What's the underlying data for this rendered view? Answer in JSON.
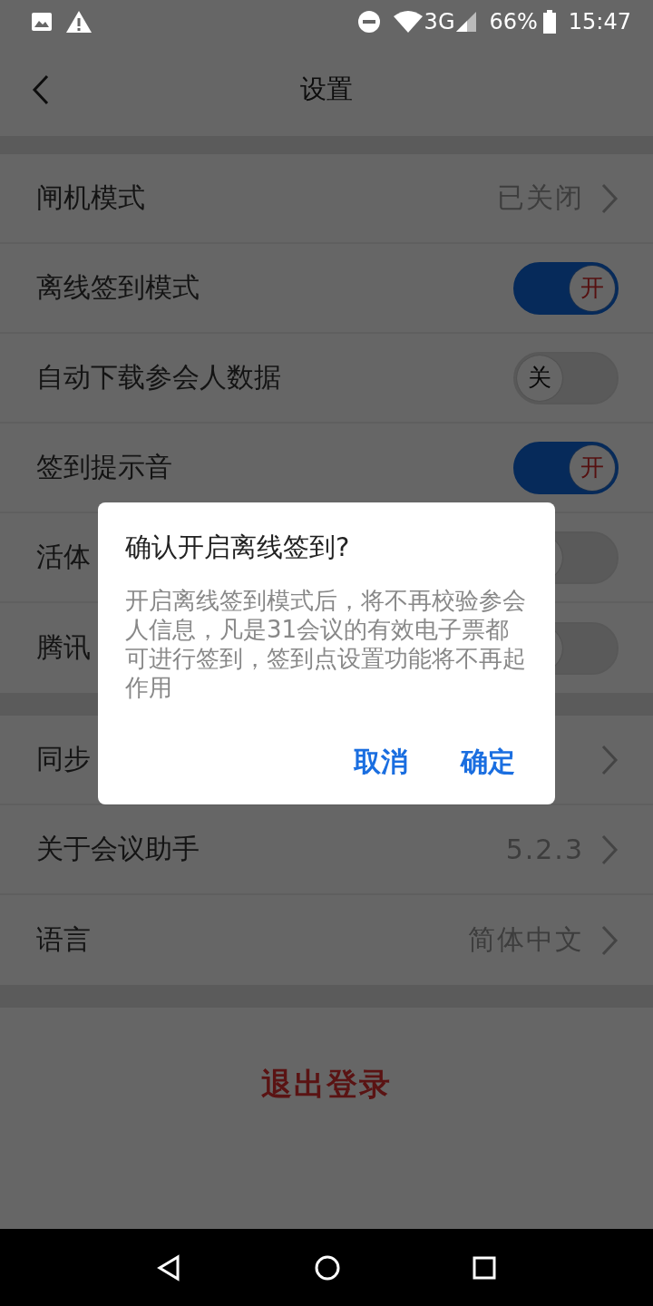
{
  "status_bar": {
    "network": "3G",
    "battery": "66%",
    "time": "15:47"
  },
  "header": {
    "title": "设置"
  },
  "sections": [
    {
      "rows": [
        {
          "kind": "link",
          "label": "闸机模式",
          "value": "已关闭"
        },
        {
          "kind": "toggle",
          "label": "离线签到模式",
          "on": true,
          "knob": "开"
        },
        {
          "kind": "toggle",
          "label": "自动下载参会人数据",
          "on": false,
          "knob": "关"
        },
        {
          "kind": "toggle",
          "label": "签到提示音",
          "on": true,
          "knob": "开"
        },
        {
          "kind": "toggle",
          "label": "活体",
          "on": false
        },
        {
          "kind": "toggle",
          "label": "腾讯",
          "on": false
        }
      ]
    },
    {
      "rows": [
        {
          "kind": "link",
          "label": "同步"
        },
        {
          "kind": "link",
          "label": "关于会议助手",
          "value": "5.2.3"
        },
        {
          "kind": "link",
          "label": "语言",
          "value": "简体中文"
        }
      ]
    }
  ],
  "logout": "退出登录",
  "dialog": {
    "title": "确认开启离线签到?",
    "message": "开启离线签到模式后，将不再校验参会人信息，凡是31会议的有效电子票都可进行签到，签到点设置功能将不再起作用",
    "buttons": [
      "取消",
      "确定"
    ]
  }
}
